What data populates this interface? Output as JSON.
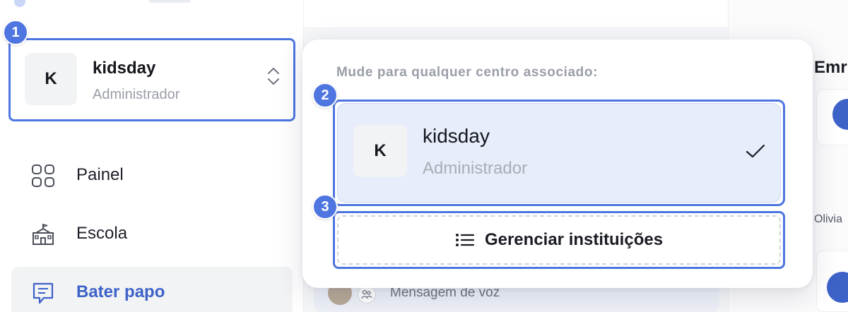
{
  "sidebar": {
    "account": {
      "initial": "K",
      "name": "kidsday",
      "role": "Administrador"
    },
    "nav": [
      {
        "label": "Painel",
        "icon": "dashboard-grid-icon",
        "active": false
      },
      {
        "label": "Escola",
        "icon": "school-building-icon",
        "active": false
      },
      {
        "label": "Bater papo",
        "icon": "chat-icon",
        "active": true
      }
    ]
  },
  "dropdown": {
    "heading": "Mude para qualquer centro associado:",
    "options": [
      {
        "initial": "K",
        "name": "kidsday",
        "role": "Administrador",
        "selected": true
      }
    ],
    "manage_label": "Gerenciar instituições"
  },
  "badges": [
    "1",
    "2",
    "3"
  ],
  "background": {
    "right_title": "Emr",
    "right_name": "Olivia",
    "chat_preview": "Mensagem de voz"
  },
  "colors": {
    "accent": "#4f75e0",
    "active_text": "#3d62c8",
    "selected_bg": "#e7edfa"
  }
}
